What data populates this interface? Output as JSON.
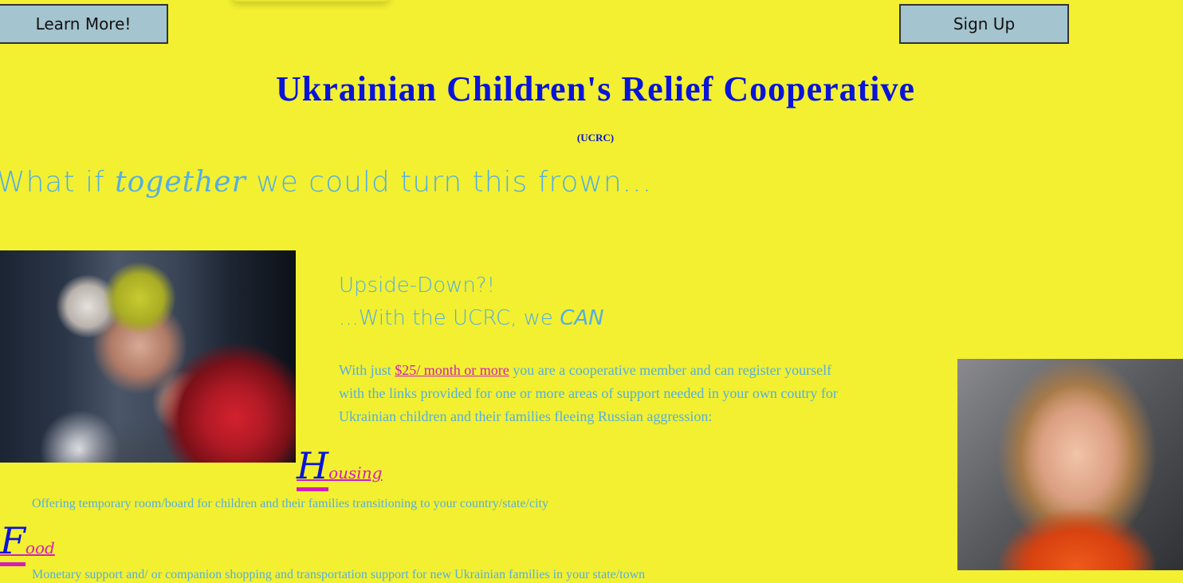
{
  "header": {
    "learn_more_label": "Learn More!",
    "sign_up_label": "Sign Up"
  },
  "title": "Ukrainian Children's Relief Cooperative",
  "abbreviation": "(UCRC)",
  "tagline": {
    "before": "What if ",
    "emphasis": "together",
    "after": " we could turn this frown..."
  },
  "upside": {
    "line1": "Upside-Down?!",
    "line2_before": "...With the UCRC, we ",
    "line2_emphasis": "CAN"
  },
  "intro": {
    "before": "With just ",
    "link": "$25/ month or more",
    "after": " you are a cooperative member and can register yourself with the links provided for one or more areas of support needed in your own coutry for Ukrainian children and their families fleeing Russian aggression:"
  },
  "sections": [
    {
      "initial": "H",
      "rest": "ousing",
      "description": "Offering temporary room/board for children and their families transitioning to your country/state/city"
    },
    {
      "initial": "F",
      "rest": "ood",
      "description": "Monetary support and/ or companion shopping and transportation support for new Ukrainian families in your state/town"
    }
  ],
  "colors": {
    "background": "#f2f030",
    "title": "#0a14d8",
    "body_text": "#55aee0",
    "link": "#d21fb8",
    "button": "#a4c4cf"
  }
}
